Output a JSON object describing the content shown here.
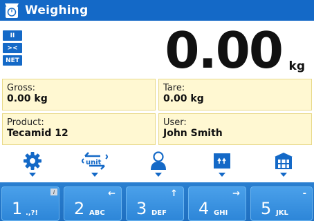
{
  "titlebar": {
    "title": "Weighing",
    "icon": "scale-icon"
  },
  "indicators": [
    "II",
    "><",
    "NET"
  ],
  "reading": {
    "value": "0.00",
    "unit": "kg"
  },
  "panels": {
    "gross": {
      "label": "Gross:",
      "value": "0.00 kg"
    },
    "tare": {
      "label": "Tare:",
      "value": "0.00 kg"
    },
    "product": {
      "label": "Product:",
      "value": "Tecamid 12"
    },
    "user": {
      "label": "User:",
      "value": "John Smith"
    }
  },
  "toolbar": {
    "unit_label": "unit",
    "icons": [
      "gear-icon",
      "unit-swap-icon",
      "user-icon",
      "box-icon",
      "database-icon"
    ]
  },
  "keypad": [
    {
      "num": "1",
      "sub": ".,?!",
      "sym": ""
    },
    {
      "num": "2",
      "sub": "ABC",
      "sym": "←"
    },
    {
      "num": "3",
      "sub": "DEF",
      "sym": "↑"
    },
    {
      "num": "4",
      "sub": "GHI",
      "sym": "→"
    },
    {
      "num": "5",
      "sub": "JKL",
      "sym": "-"
    }
  ],
  "colors": {
    "accent": "#1469c7",
    "panel_bg": "#fff8d2",
    "keypad": "#2a7fd0"
  }
}
